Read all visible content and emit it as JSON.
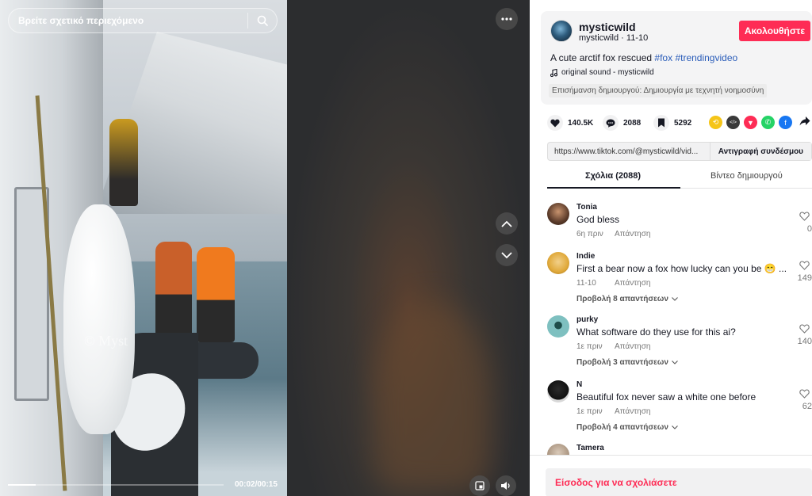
{
  "search": {
    "placeholder": "Βρείτε σχετικό περιεχόμενο",
    "icon": "search-icon"
  },
  "video": {
    "time": "00:02/00:15",
    "progress_fraction": 0.13,
    "watermark": "© Myst"
  },
  "author": {
    "username": "mysticwild",
    "handle_date": "mysticwild · 11-10",
    "follow_label": "Ακολουθήστε"
  },
  "description": {
    "text": "A cute arctif fox rescued ",
    "tag1": "#fox",
    "tag2": "#trendingvideo"
  },
  "sound": "original sound - mysticwild",
  "creator_label": "Επισήμανση δημιουργού: Δημιουργία με τεχνητή νοημοσύνη",
  "stats": {
    "likes": "140.5K",
    "comments": "2088",
    "saves": "5292"
  },
  "share_icons": [
    {
      "name": "repost-icon",
      "color": "#f5c518"
    },
    {
      "name": "embed-icon",
      "color": "#3a3a3a"
    },
    {
      "name": "send-icon",
      "color": "#fe2c55"
    },
    {
      "name": "whatsapp-icon",
      "color": "#25d366"
    },
    {
      "name": "facebook-icon",
      "color": "#1877f2"
    }
  ],
  "link": {
    "url": "https://www.tiktok.com/@mysticwild/vid...",
    "copy_label": "Αντιγραφή συνδέσμου"
  },
  "tabs": {
    "comments": "Σχόλια (2088)",
    "creator_videos": "Βίντεο δημιουργού"
  },
  "comments": [
    {
      "user": "Tonia",
      "text": "God bless",
      "time": "6η πριν",
      "reply": "Απάντηση",
      "likes": "0",
      "more": ""
    },
    {
      "user": "Indie",
      "text": "First a bear now a fox how lucky can you be 😁 ...",
      "time": "11-10",
      "reply": "Απάντηση",
      "likes": "149",
      "more": "Προβολή 8 απαντήσεων"
    },
    {
      "user": "purky",
      "text": "What software do they use for this ai?",
      "time": "1ε πριν",
      "reply": "Απάντηση",
      "likes": "140",
      "more": "Προβολή 3 απαντήσεων"
    },
    {
      "user": "N",
      "text": "Beautiful fox never saw a white one before",
      "time": "1ε πριν",
      "reply": "Απάντηση",
      "likes": "62",
      "more": "Προβολή 4 απαντήσεων"
    },
    {
      "user": "Tamera",
      "text": "",
      "time": "",
      "reply": "",
      "likes": "",
      "more": ""
    }
  ],
  "login_prompt": "Είσοδος για να σχολιάσετε",
  "colors": {
    "accent": "#fe2c55",
    "hashtag": "#2b5db9"
  }
}
